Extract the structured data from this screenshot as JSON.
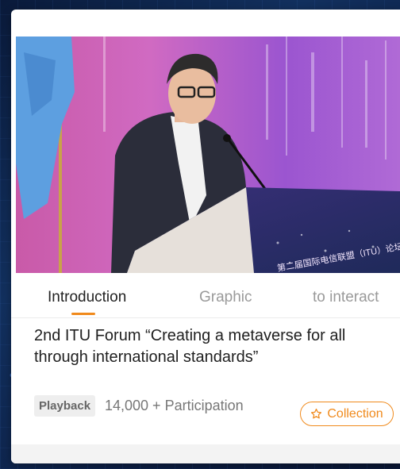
{
  "tabs": [
    {
      "label": "Introduction",
      "active": true
    },
    {
      "label": "Graphic",
      "active": false
    },
    {
      "label": "to interact",
      "active": false
    }
  ],
  "event": {
    "title": "2nd ITU Forum “Creating a metaverse for all through international standards”",
    "badge": "Playback",
    "participation": "14,000 + Participation",
    "collection_label": "Collection",
    "collection_icon": "star-outline-icon"
  },
  "video": {
    "banner_text": "第二届国际电信联盟（ITU）论坛"
  },
  "colors": {
    "accent": "#f08a1c",
    "stage_background": "#c44ea8"
  }
}
